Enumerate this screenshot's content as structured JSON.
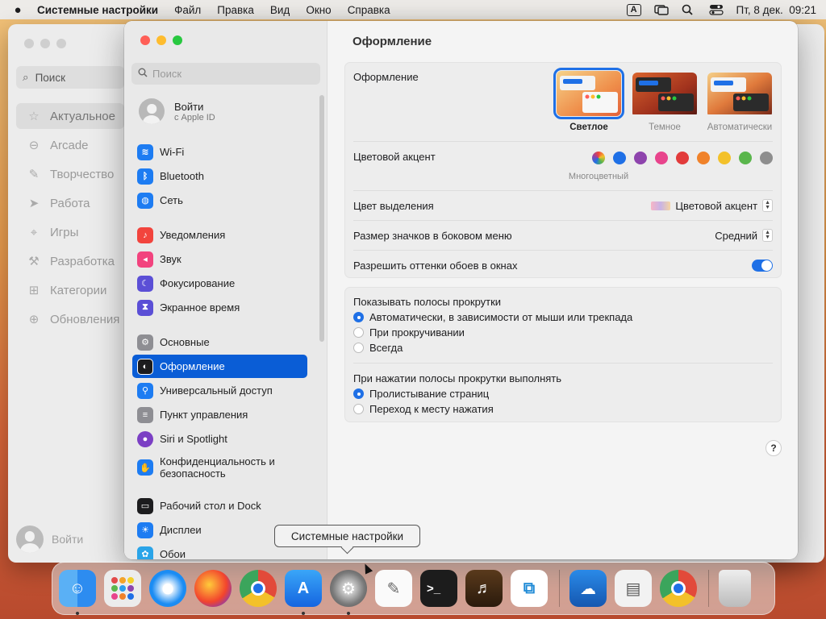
{
  "menubar": {
    "app_name": "Системные настройки",
    "items": [
      "Файл",
      "Правка",
      "Вид",
      "Окно",
      "Справка"
    ],
    "kbd_badge": "A",
    "datetime": "Пт, 8 дек.  09:21"
  },
  "bg_window": {
    "search": "Поиск",
    "items": [
      {
        "label": "Актуальное",
        "icon": "star-icon"
      },
      {
        "label": "Arcade",
        "icon": "gamepad-icon"
      },
      {
        "label": "Творчество",
        "icon": "brush-icon"
      },
      {
        "label": "Работа",
        "icon": "paperplane-icon"
      },
      {
        "label": "Игры",
        "icon": "rocket-icon"
      },
      {
        "label": "Разработка",
        "icon": "hammer-icon"
      },
      {
        "label": "Категории",
        "icon": "grid-icon"
      },
      {
        "label": "Обновления",
        "icon": "download-icon"
      }
    ],
    "user": "Войти"
  },
  "sidebar": {
    "search_placeholder": "Поиск",
    "user_name": "Войти",
    "user_sub": "с Apple ID",
    "items": [
      {
        "label": "Wi-Fi",
        "icon": "wifi-icon",
        "color": "#1d7cf2"
      },
      {
        "label": "Bluetooth",
        "icon": "bluetooth-icon",
        "color": "#1d7cf2"
      },
      {
        "label": "Сеть",
        "icon": "globe-icon",
        "color": "#1d7cf2"
      },
      {
        "label": "Уведомления",
        "icon": "bell-icon",
        "color": "#f2443d"
      },
      {
        "label": "Звук",
        "icon": "speaker-icon",
        "color": "#f2437e"
      },
      {
        "label": "Фокусирование",
        "icon": "moon-icon",
        "color": "#5b4fd6"
      },
      {
        "label": "Экранное время",
        "icon": "hourglass-icon",
        "color": "#5b4fd6"
      },
      {
        "label": "Основные",
        "icon": "gear-icon",
        "color": "#8e8e93"
      },
      {
        "label": "Оформление",
        "icon": "appearance-icon",
        "color": "#1c1c1e"
      },
      {
        "label": "Универсальный доступ",
        "icon": "accessibility-icon",
        "color": "#1d7cf2"
      },
      {
        "label": "Пункт управления",
        "icon": "control-center-icon",
        "color": "#8e8e93"
      },
      {
        "label": "Siri и Spotlight",
        "icon": "siri-icon",
        "color": "#7b3fc4"
      },
      {
        "label": "Конфиденциальность и безопасность",
        "icon": "hand-icon",
        "color": "#1d7cf2"
      },
      {
        "label": "Рабочий стол и Dock",
        "icon": "desktop-icon",
        "color": "#1c1c1e"
      },
      {
        "label": "Дисплеи",
        "icon": "sun-icon",
        "color": "#1d7cf2"
      },
      {
        "label": "Обои",
        "icon": "flower-icon",
        "color": "#2aa4e8"
      }
    ]
  },
  "content": {
    "title": "Оформление",
    "appearance_label": "Оформление",
    "themes": [
      "Светлое",
      "Темное",
      "Автоматически"
    ],
    "accent_label": "Цветовой акцент",
    "accent_caption": "Многоцветный",
    "accent_colors": [
      "#1f70e6",
      "#8e44ad",
      "#e8448c",
      "#e23b3b",
      "#f0822a",
      "#f3c12a",
      "#5ab64c",
      "#8e8e8e"
    ],
    "highlight_label": "Цвет выделения",
    "highlight_value": "Цветовой акцент",
    "icon_size_label": "Размер значков в боковом меню",
    "icon_size_value": "Средний",
    "tint_label": "Разрешить оттенки обоев в окнах",
    "scrollbars_label": "Показывать полосы прокрутки",
    "scrollbars_options": [
      "Автоматически, в зависимости от мыши или трекпада",
      "При прокручивании",
      "Всегда"
    ],
    "click_label": "При нажатии полосы прокрутки выполнять",
    "click_options": [
      "Пролистывание страниц",
      "Переход к месту нажатия"
    ],
    "help": "?"
  },
  "tooltip": "Системные настройки",
  "dock": {
    "items": [
      {
        "name": "finder-icon",
        "color": "#2d8cf0",
        "running": true
      },
      {
        "name": "launchpad-icon",
        "color": "#e9e9e9",
        "running": false
      },
      {
        "name": "safari-icon",
        "color": "#1b8cf3",
        "running": false
      },
      {
        "name": "firefox-icon",
        "color": "#6b3bd6",
        "running": false
      },
      {
        "name": "chrome-icon",
        "color": "#ffffff",
        "running": false
      },
      {
        "name": "app-store-icon",
        "color": "#1d86f3",
        "running": true
      },
      {
        "name": "system-settings-icon",
        "color": "#8a8a8a",
        "running": true
      },
      {
        "name": "textedit-icon",
        "color": "#f5f5f5",
        "running": false
      },
      {
        "name": "terminal-icon",
        "color": "#1c1c1c",
        "running": false
      },
      {
        "name": "garageband-icon",
        "color": "#3a2a1a",
        "running": false
      },
      {
        "name": "vscode-icon",
        "color": "#ffffff",
        "running": false
      },
      {
        "name": "weather-icon",
        "color": "#2a7ad8",
        "running": false
      },
      {
        "name": "archive-utility-icon",
        "color": "#f0f0f0",
        "running": false
      },
      {
        "name": "chrome-icon-2",
        "color": "#ffffff",
        "running": false
      },
      {
        "name": "trash-icon",
        "color": "#d9d9d9",
        "running": false
      }
    ]
  }
}
